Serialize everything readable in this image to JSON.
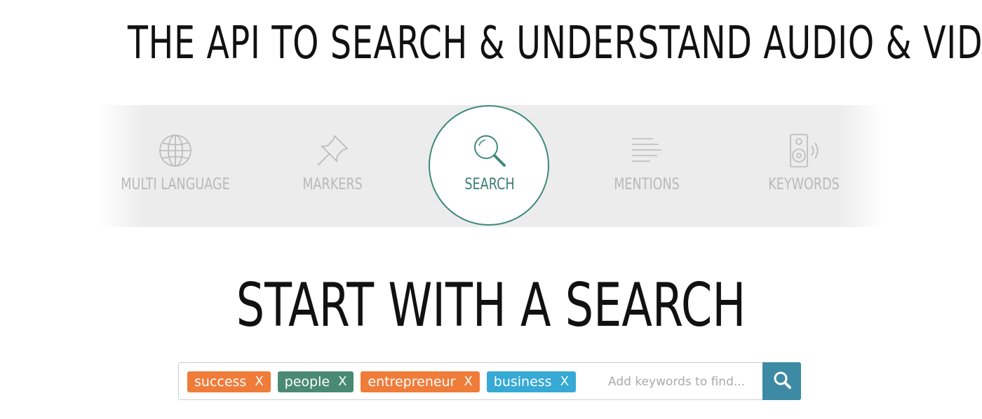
{
  "header": {
    "headline": "THE API TO SEARCH & UNDERSTAND AUDIO & VIDEO"
  },
  "features": [
    {
      "label": "MULTI LANGUAGE",
      "icon": "globe-icon",
      "active": false
    },
    {
      "label": "MARKERS",
      "icon": "pushpin-icon",
      "active": false
    },
    {
      "label": "SEARCH",
      "icon": "magnifier-icon",
      "active": true
    },
    {
      "label": "MENTIONS",
      "icon": "text-lines-icon",
      "active": false
    },
    {
      "label": "KEYWORDS",
      "icon": "speaker-icon",
      "active": false
    }
  ],
  "search_section": {
    "title": "START WITH A SEARCH",
    "tags": [
      {
        "text": "success",
        "remove": "X",
        "color": "#f07c3a"
      },
      {
        "text": "people",
        "remove": "X",
        "color": "#4a8a74"
      },
      {
        "text": "entrepreneur",
        "remove": "X",
        "color": "#f07c3a"
      },
      {
        "text": "business",
        "remove": "X",
        "color": "#36a9d4"
      }
    ],
    "placeholder": "Add keywords to find...",
    "search_button_icon": "search-icon"
  },
  "colors": {
    "active_accent": "#3e8a78",
    "inactive_feature": "#b9b9b9",
    "search_button": "#3c8aa3"
  }
}
